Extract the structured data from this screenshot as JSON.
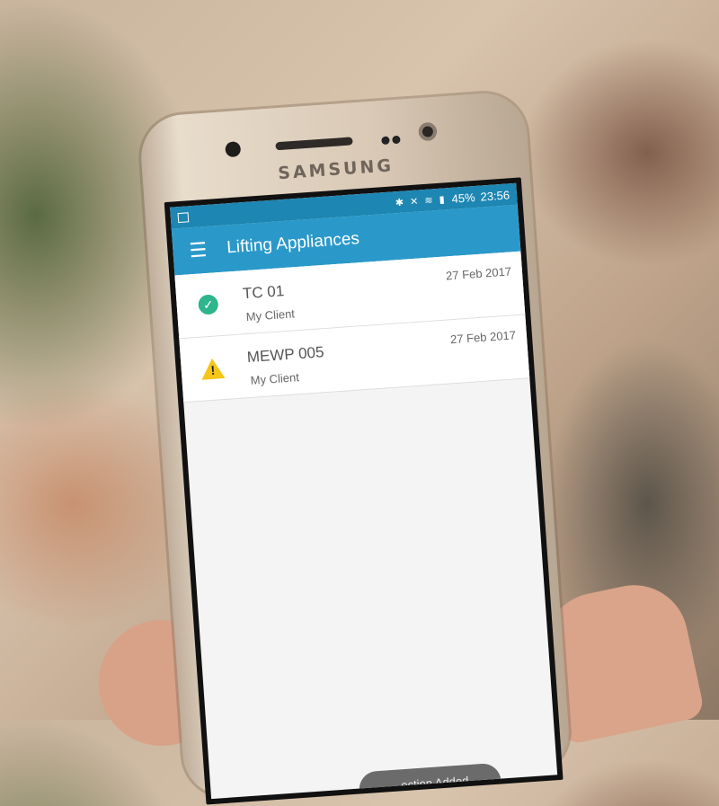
{
  "device": {
    "brand": "SAMSUNG"
  },
  "status_bar": {
    "battery": "45%",
    "time": "23:56",
    "icons": "✱ ✕ ≋ ▮"
  },
  "app_bar": {
    "title": "Lifting Appliances",
    "menu_icon": "hamburger-icon"
  },
  "appliances": [
    {
      "name": "TC 01",
      "client": "My Client",
      "date": "27 Feb 2017",
      "status": "ok",
      "icon": "check-circle-icon"
    },
    {
      "name": "MEWP 005",
      "client": "My Client",
      "date": "27 Feb 2017",
      "status": "warning",
      "icon": "warning-icon"
    }
  ],
  "toast": {
    "text": "...ection Added"
  },
  "colors": {
    "primary": "#2a99c9",
    "status_bar": "#1e86b2",
    "ok": "#2eb58c",
    "warning": "#f5c518"
  }
}
